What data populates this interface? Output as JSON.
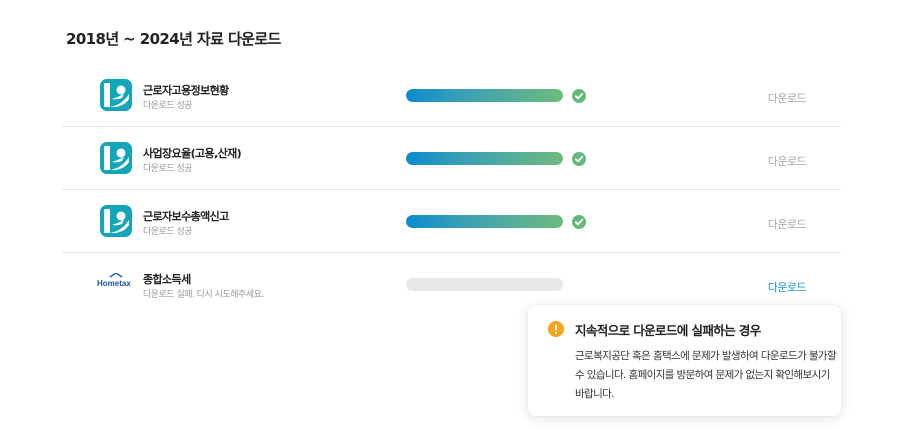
{
  "page": {
    "title": "2018년 ~ 2024년 자료 다운로드"
  },
  "colors": {
    "progress_start": "#0a8ccf",
    "progress_end": "#6dbb7e",
    "success": "#65b97c",
    "warning": "#f4a51c",
    "link_active": "#1a93d3",
    "link_inactive": "#a8a8a8"
  },
  "downloads": [
    {
      "name": "근로자고용정보현황",
      "status": "다운로드 성공",
      "action": "다운로드",
      "progress": 100,
      "success": true,
      "icon": "comwel-logo-icon"
    },
    {
      "name": "사업장요율(고용,산재)",
      "status": "다운로드 성공",
      "action": "다운로드",
      "progress": 100,
      "success": true,
      "icon": "comwel-logo-icon"
    },
    {
      "name": "근로자보수총액신고",
      "status": "다운로드 성공",
      "action": "다운로드",
      "progress": 100,
      "success": true,
      "icon": "comwel-logo-icon"
    },
    {
      "name": "종합소득세",
      "status": "다운로드 실패. 다시 시도해주세요.",
      "action": "다운로드",
      "progress": 0,
      "success": false,
      "icon": "hometax-logo-icon",
      "logo_text": "Hometax"
    }
  ],
  "tooltip": {
    "title": "지속적으로 다운로드에 실패하는 경우",
    "body": "근로복지공단 혹은 홈택스에 문제가 발생하여 다운로드가 불가할 수 있습니다. 홈페이지를 방문하여 문제가 없는지 확인해보시기 바랍니다.",
    "icon": "warning-icon"
  }
}
